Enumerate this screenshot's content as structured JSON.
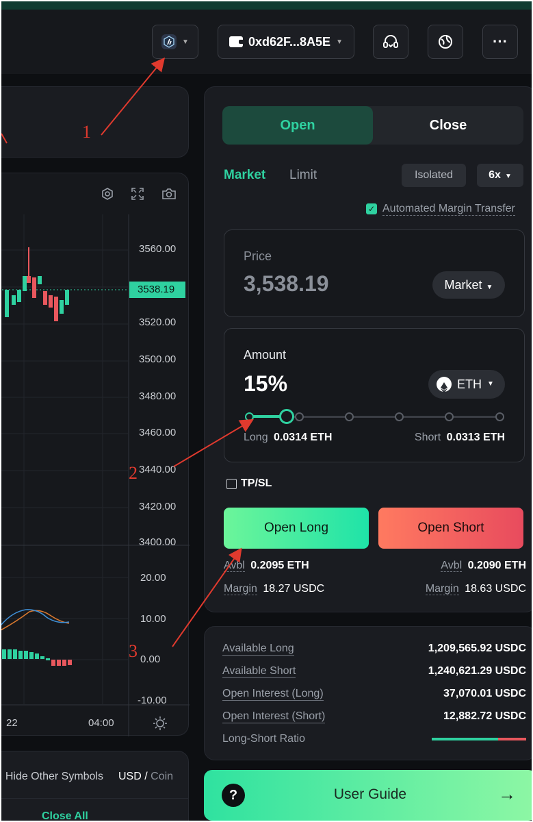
{
  "topbar": {
    "wallet_address": "0xd62F...8A5E",
    "network_icon": "arbitrum-icon",
    "support_icon": "headset-icon",
    "globe_icon": "globe-icon",
    "more_label": "···"
  },
  "chart": {
    "price_ticks": [
      "3560.00",
      "3520.00",
      "3500.00",
      "3480.00",
      "3460.00",
      "3440.00",
      "3420.00",
      "3400.00"
    ],
    "current_price_tag": "3538.19",
    "indicator_ticks": [
      "20.00",
      "10.00",
      "0.00",
      "-10.00"
    ],
    "time_labels": [
      "22",
      "04:00"
    ],
    "toolbar_icons": [
      "settings-icon",
      "fullscreen-icon",
      "camera-icon"
    ]
  },
  "positions_bar": {
    "hide_other_symbols": "Hide Other Symbols",
    "usd_label": "USD",
    "slash": "/",
    "coin_label": "Coin",
    "close_all": "Close All"
  },
  "order": {
    "tab_open": "Open",
    "tab_close": "Close",
    "type_market": "Market",
    "type_limit": "Limit",
    "margin_mode": "Isolated",
    "leverage": "6x",
    "auto_margin_label": "Automated Margin Transfer",
    "price_label": "Price",
    "price_value": "3,538.19",
    "price_type": "Market",
    "amount_label": "Amount",
    "amount_percent": "15%",
    "amount_fraction": 0.15,
    "amount_asset": "ETH",
    "long_label": "Long",
    "long_value": "0.0314 ETH",
    "short_label": "Short",
    "short_value": "0.0313 ETH",
    "tpsl_label": "TP/SL",
    "open_long": "Open Long",
    "open_short": "Open Short",
    "avbl_label": "Avbl",
    "avbl_long": "0.2095 ETH",
    "avbl_short": "0.2090 ETH",
    "margin_label": "Margin",
    "margin_long": "18.27 USDC",
    "margin_short": "18.63 USDC"
  },
  "stats": {
    "available_long_label": "Available Long",
    "available_long": "1,209,565.92 USDC",
    "available_short_label": "Available Short",
    "available_short": "1,240,621.29 USDC",
    "oi_long_label": "Open Interest (Long)",
    "oi_long": "37,070.01 USDC",
    "oi_short_label": "Open Interest (Short)",
    "oi_short": "12,882.72 USDC",
    "ratio_label": "Long-Short Ratio",
    "long_ratio_fraction": 0.7
  },
  "guide": {
    "label": "User Guide",
    "question": "?",
    "arrow": "→"
  },
  "annotations": {
    "n1": "1",
    "n2": "2",
    "n3": "3"
  },
  "colors": {
    "accent_green": "#2fd1a0",
    "short_red": "#e8575d",
    "background": "#0d0f12",
    "panel": "#1a1c21"
  }
}
